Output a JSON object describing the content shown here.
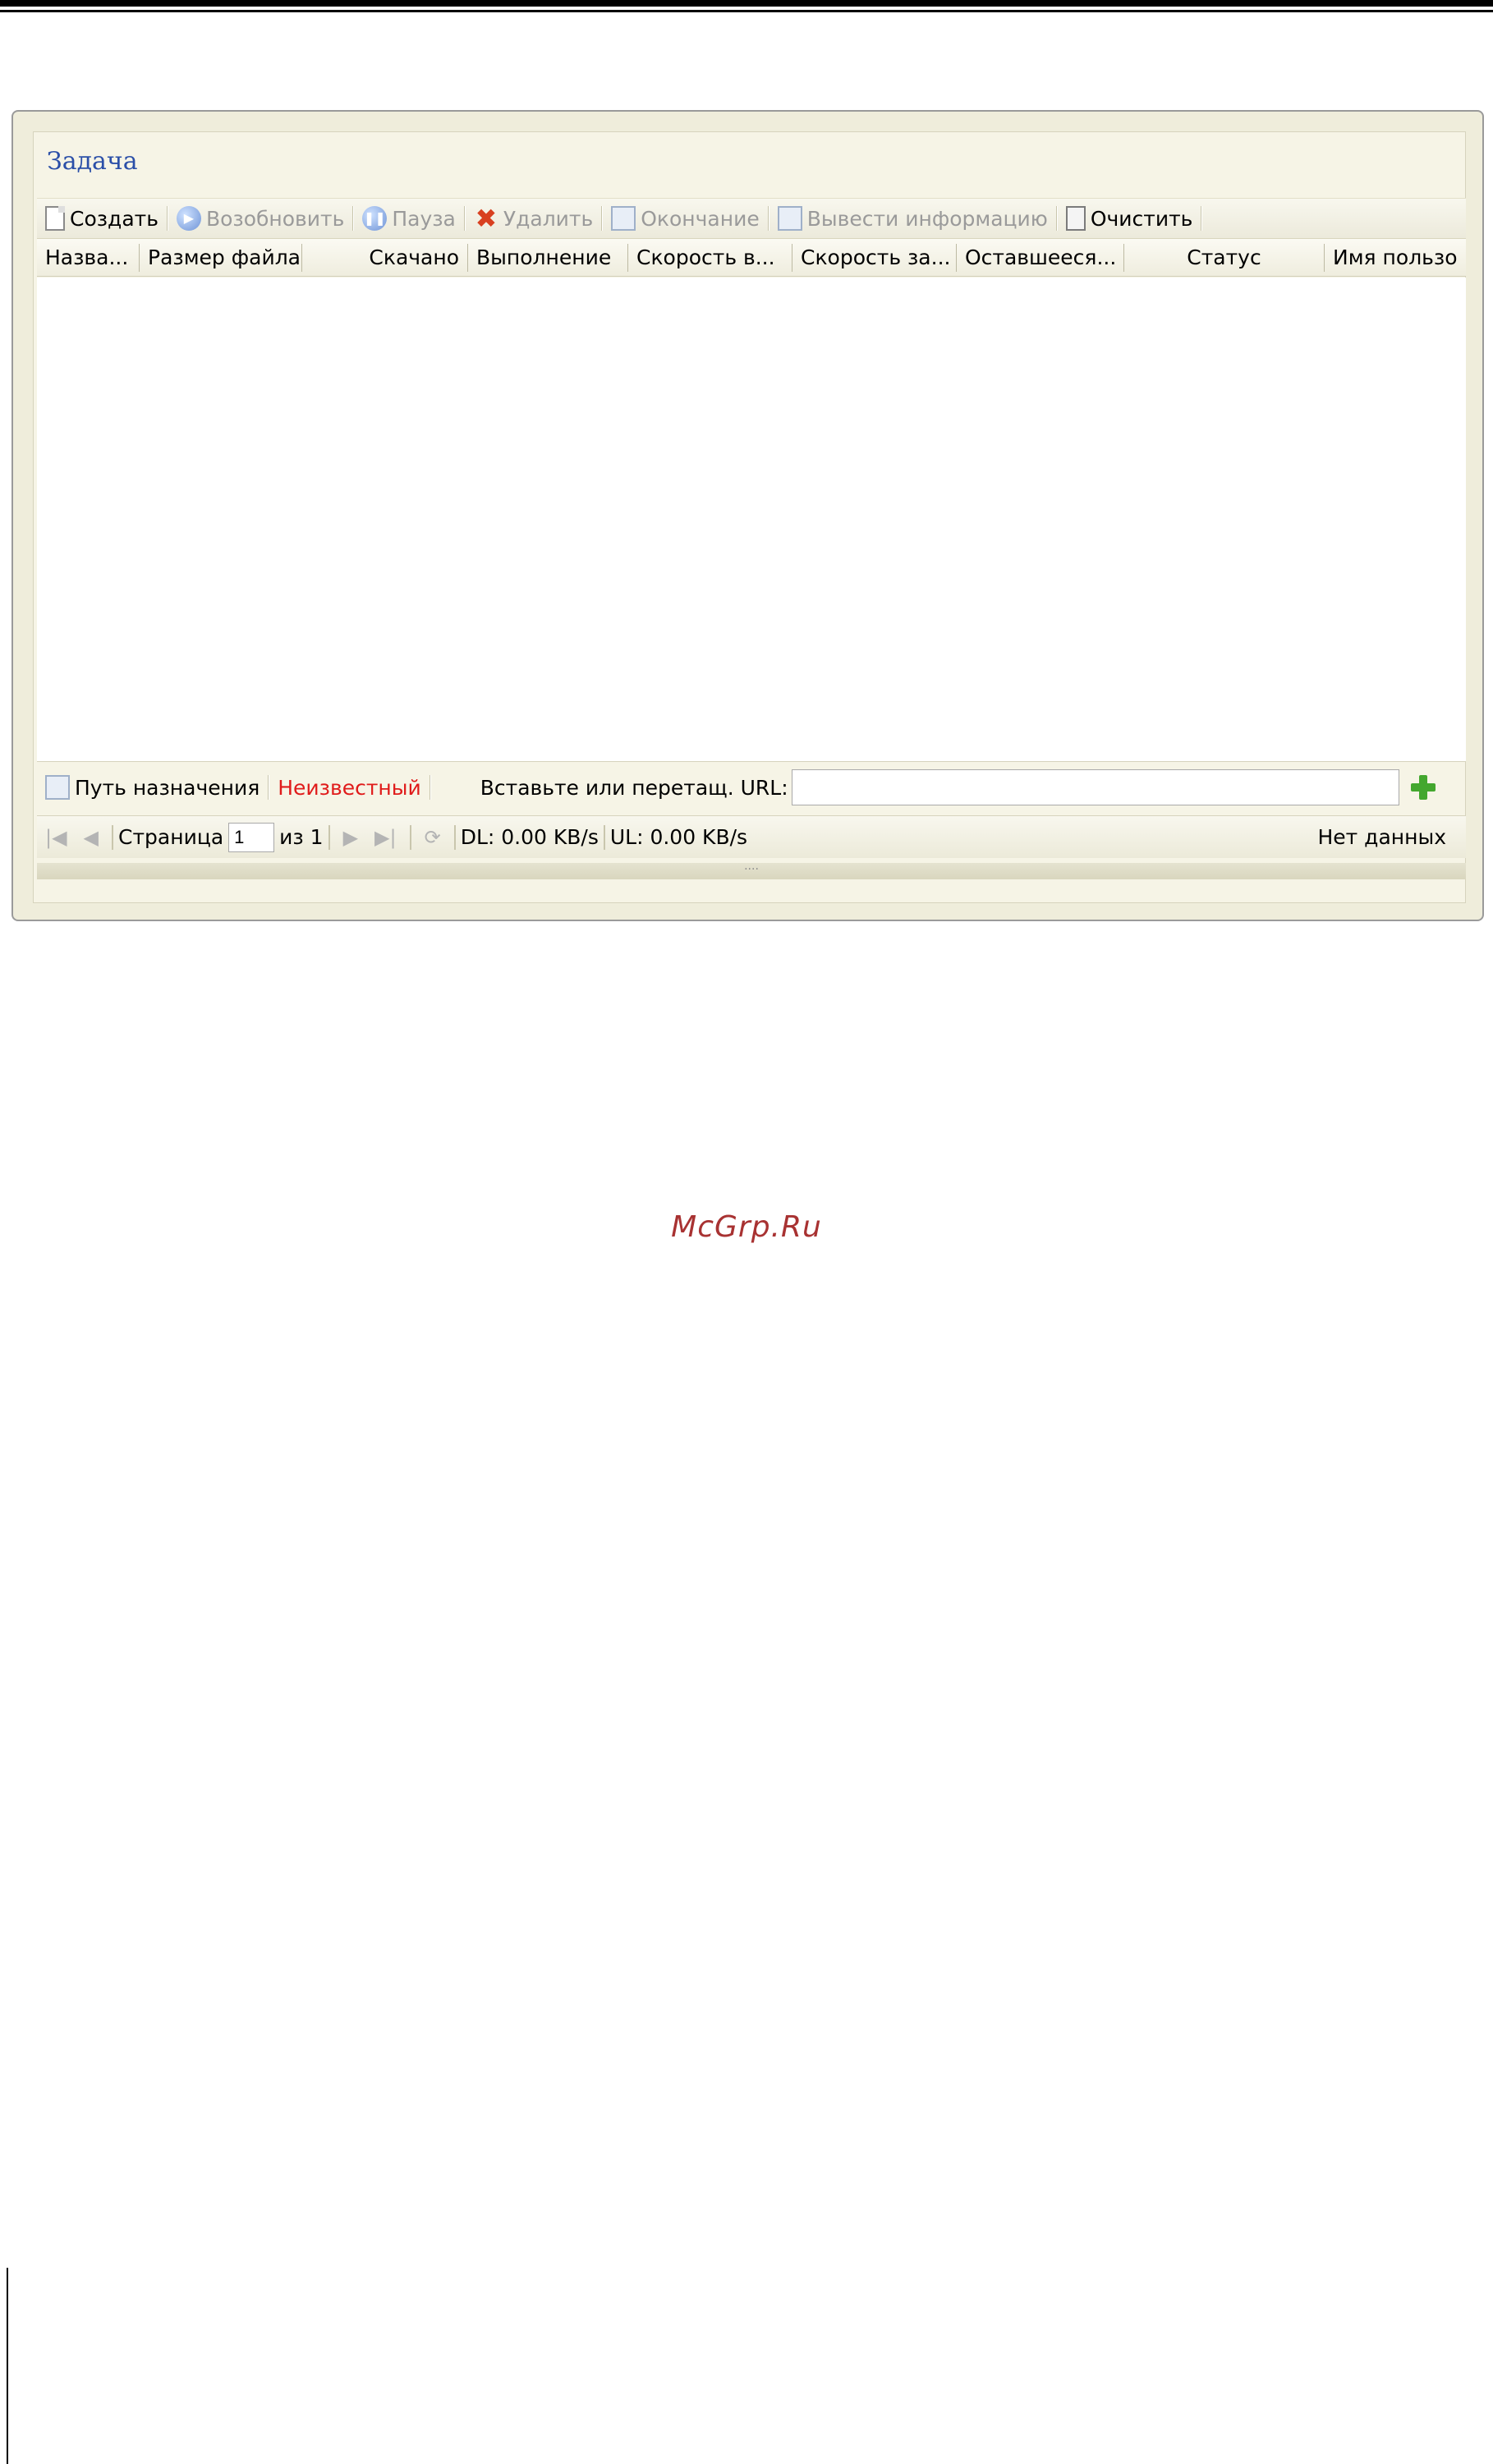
{
  "panel": {
    "title": "Задача"
  },
  "toolbar": {
    "create": "Создать",
    "resume": "Возобновить",
    "pause": "Пауза",
    "delete": "Удалить",
    "finish": "Окончание",
    "info": "Вывести информацию",
    "clear": "Очистить"
  },
  "columns": {
    "name": "Назва...",
    "size": "Размер файла",
    "downloaded": "Скачано",
    "progress": "Выполнение",
    "dl_speed": "Скорость в...",
    "ul_speed": "Скорость за...",
    "remaining": "Оставшееся...",
    "status": "Статус",
    "user": "Имя пользо"
  },
  "dest": {
    "label": "Путь назначения",
    "value": "Неизвестный",
    "url_label": "Вставьте или перетащ. URL:",
    "url_value": ""
  },
  "pager": {
    "page_label": "Страница",
    "page_value": "1",
    "of_label": "из 1",
    "dl": "DL:  0.00 KB/s",
    "ul": "UL:  0.00 KB/s",
    "empty": "Нет данных"
  },
  "footer": {
    "watermark": "McGrp.Ru"
  }
}
